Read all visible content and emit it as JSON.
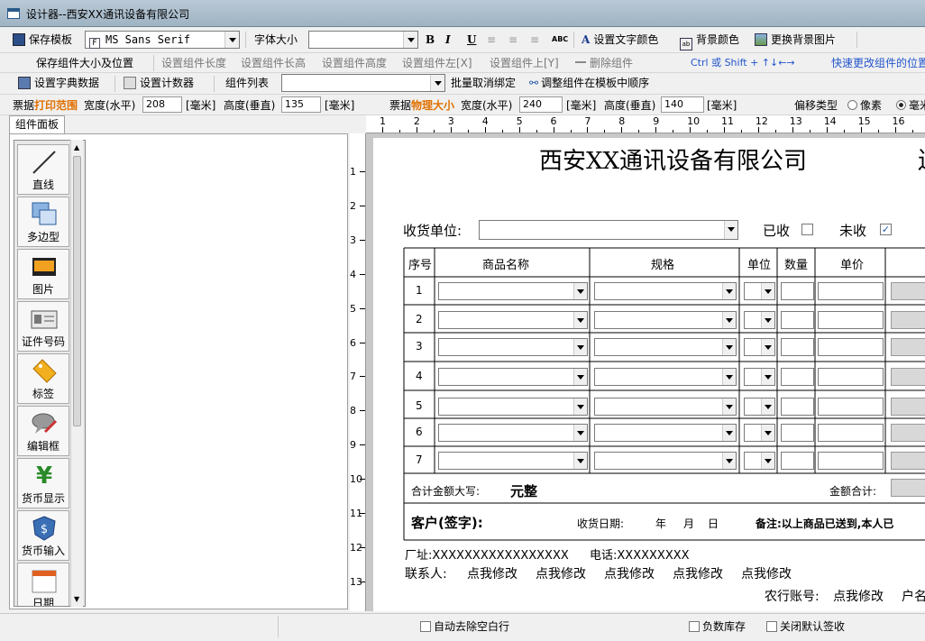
{
  "window": {
    "title": "设计器--西安XX通讯设备有限公司"
  },
  "toolbar1": {
    "save_template": "保存模板",
    "font_name": "MS Sans Serif",
    "font_size_label": "字体大小",
    "font_size_value": "",
    "bold": "B",
    "italic": "I",
    "underline": "U",
    "abc": "ABC",
    "text_color": "设置文字颜色",
    "bg_color": "背景颜色",
    "change_bg_image": "更换背景图片"
  },
  "toolbar2": {
    "save_size_pos": "保存组件大小及位置",
    "set_len": "设置组件长度",
    "set_len_h": "设置组件长高",
    "set_height": "设置组件高度",
    "set_left": "设置组件左[X]",
    "set_top": "设置组件上[Y]",
    "delete": "删除组件",
    "hint": "Ctrl 或 Shift + ↑↓←→",
    "hint2": "快速更改组件的位置"
  },
  "toolbar3": {
    "dict_data": "设置字典数据",
    "counter": "设置计数器",
    "comp_list": "组件列表",
    "batch_unbind": "批量取消绑定",
    "adjust_order": "调整组件在模板中顺序"
  },
  "toolbar4": {
    "print_range_prefix": "票据",
    "print_range": "打印范围",
    "w_label": "宽度(水平)",
    "w_val": "208",
    "unit": "[毫米]",
    "h_label": "高度(垂直)",
    "h_val": "135",
    "unit2": "[毫米]",
    "phys_prefix": "票据",
    "phys": "物理大小",
    "w2_label": "宽度(水平)",
    "w2_val": "240",
    "unit3": "[毫米]",
    "h2_label": "高度(垂直)",
    "h2_val": "140",
    "unit4": "[毫米]",
    "offset_type": "偏移类型",
    "px": "像素",
    "mm": "毫米"
  },
  "panel": {
    "tab": "组件面板",
    "components": [
      "直线",
      "多边型",
      "图片",
      "证件号码",
      "标签",
      "编辑框",
      "货币显示",
      "货币输入",
      "日期"
    ]
  },
  "ruler": {
    "top": [
      "1",
      "2",
      "3",
      "4",
      "5",
      "6",
      "7",
      "8",
      "9",
      "10",
      "11",
      "12",
      "13",
      "14",
      "15",
      "16"
    ],
    "left": [
      "1",
      "2",
      "3",
      "4",
      "5",
      "6",
      "7",
      "8",
      "9",
      "10",
      "11",
      "12",
      "13"
    ]
  },
  "doc": {
    "company": "西安XX通讯设备有限公司",
    "title_tail": "送",
    "receiver_label": "收货单位:",
    "received": "已收",
    "not_received": "未收",
    "headers": [
      "序号",
      "商品名称",
      "规格",
      "单位",
      "数量",
      "单价"
    ],
    "rows": [
      "1",
      "2",
      "3",
      "4",
      "5",
      "6",
      "7"
    ],
    "total_upper_label": "合计金额大写:",
    "total_upper_value": "元整",
    "total_amount_label": "金额合计:",
    "customer_sign": "客户(签字):",
    "receive_date": "收货日期:",
    "year": "年",
    "month": "月",
    "day": "日",
    "remark": "备注:以上商品已送到,本人已",
    "factory": "厂址:XXXXXXXXXXXXXXXXX",
    "phone": "电话:XXXXXXXXX",
    "contact_label": "联系人:",
    "contacts": [
      "点我修改",
      "点我修改",
      "点我修改",
      "点我修改",
      "点我修改"
    ],
    "bank_label": "农行账号:",
    "bank_value": "点我修改",
    "account_name": "户名"
  },
  "status": {
    "auto_remove": "自动去除空白行",
    "negative_stock": "负数库存",
    "close_default_sign": "关闭默认签收"
  }
}
